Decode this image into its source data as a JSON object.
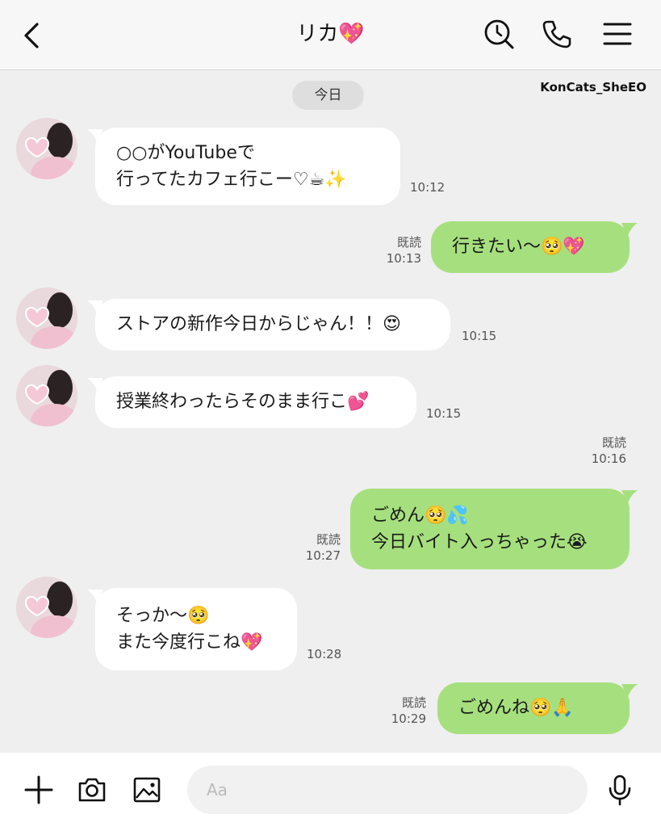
{
  "header": {
    "title": "リカ💖",
    "back_icon": "chevron-left-icon",
    "icons": [
      "search-icon",
      "phone-icon",
      "menu-icon"
    ]
  },
  "watermark": "KonCats_SheEO",
  "date_divider": "今日",
  "messages": [
    {
      "side": "in",
      "lines": [
        "○○がYouTubeで",
        "行ってたカフェ行こー♡☕✨"
      ],
      "time": "10:12"
    },
    {
      "side": "out",
      "lines": [
        "行きたい〜🥺💖"
      ],
      "read": "既読",
      "time": "10:13"
    },
    {
      "side": "in",
      "lines": [
        "ストアの新作今日からじゃん！！😍"
      ],
      "time": "10:15"
    },
    {
      "side": "in",
      "lines": [
        "授業終わったらそのまま行こ💕"
      ],
      "time": "10:15"
    },
    {
      "side": "read-marker",
      "read": "既読",
      "time": "10:16"
    },
    {
      "side": "out",
      "lines": [
        "ごめん🥺💦",
        "今日バイト入っちゃった😭"
      ],
      "read": "既読",
      "time": "10:27"
    },
    {
      "side": "in",
      "lines": [
        "そっか〜🥺",
        "また今度行こね💖"
      ],
      "time": "10:28"
    },
    {
      "side": "out",
      "lines": [
        "ごめんね🥺🙏"
      ],
      "read": "既読",
      "time": "10:29"
    }
  ],
  "footer": {
    "icons": [
      "plus-icon",
      "camera-icon",
      "image-icon",
      "emoji-icon",
      "mic-icon"
    ],
    "input_placeholder": "Aa"
  },
  "colors": {
    "outgoing_bubble": "#a6e07e",
    "incoming_bubble": "#ffffff",
    "background": "#efefef"
  }
}
